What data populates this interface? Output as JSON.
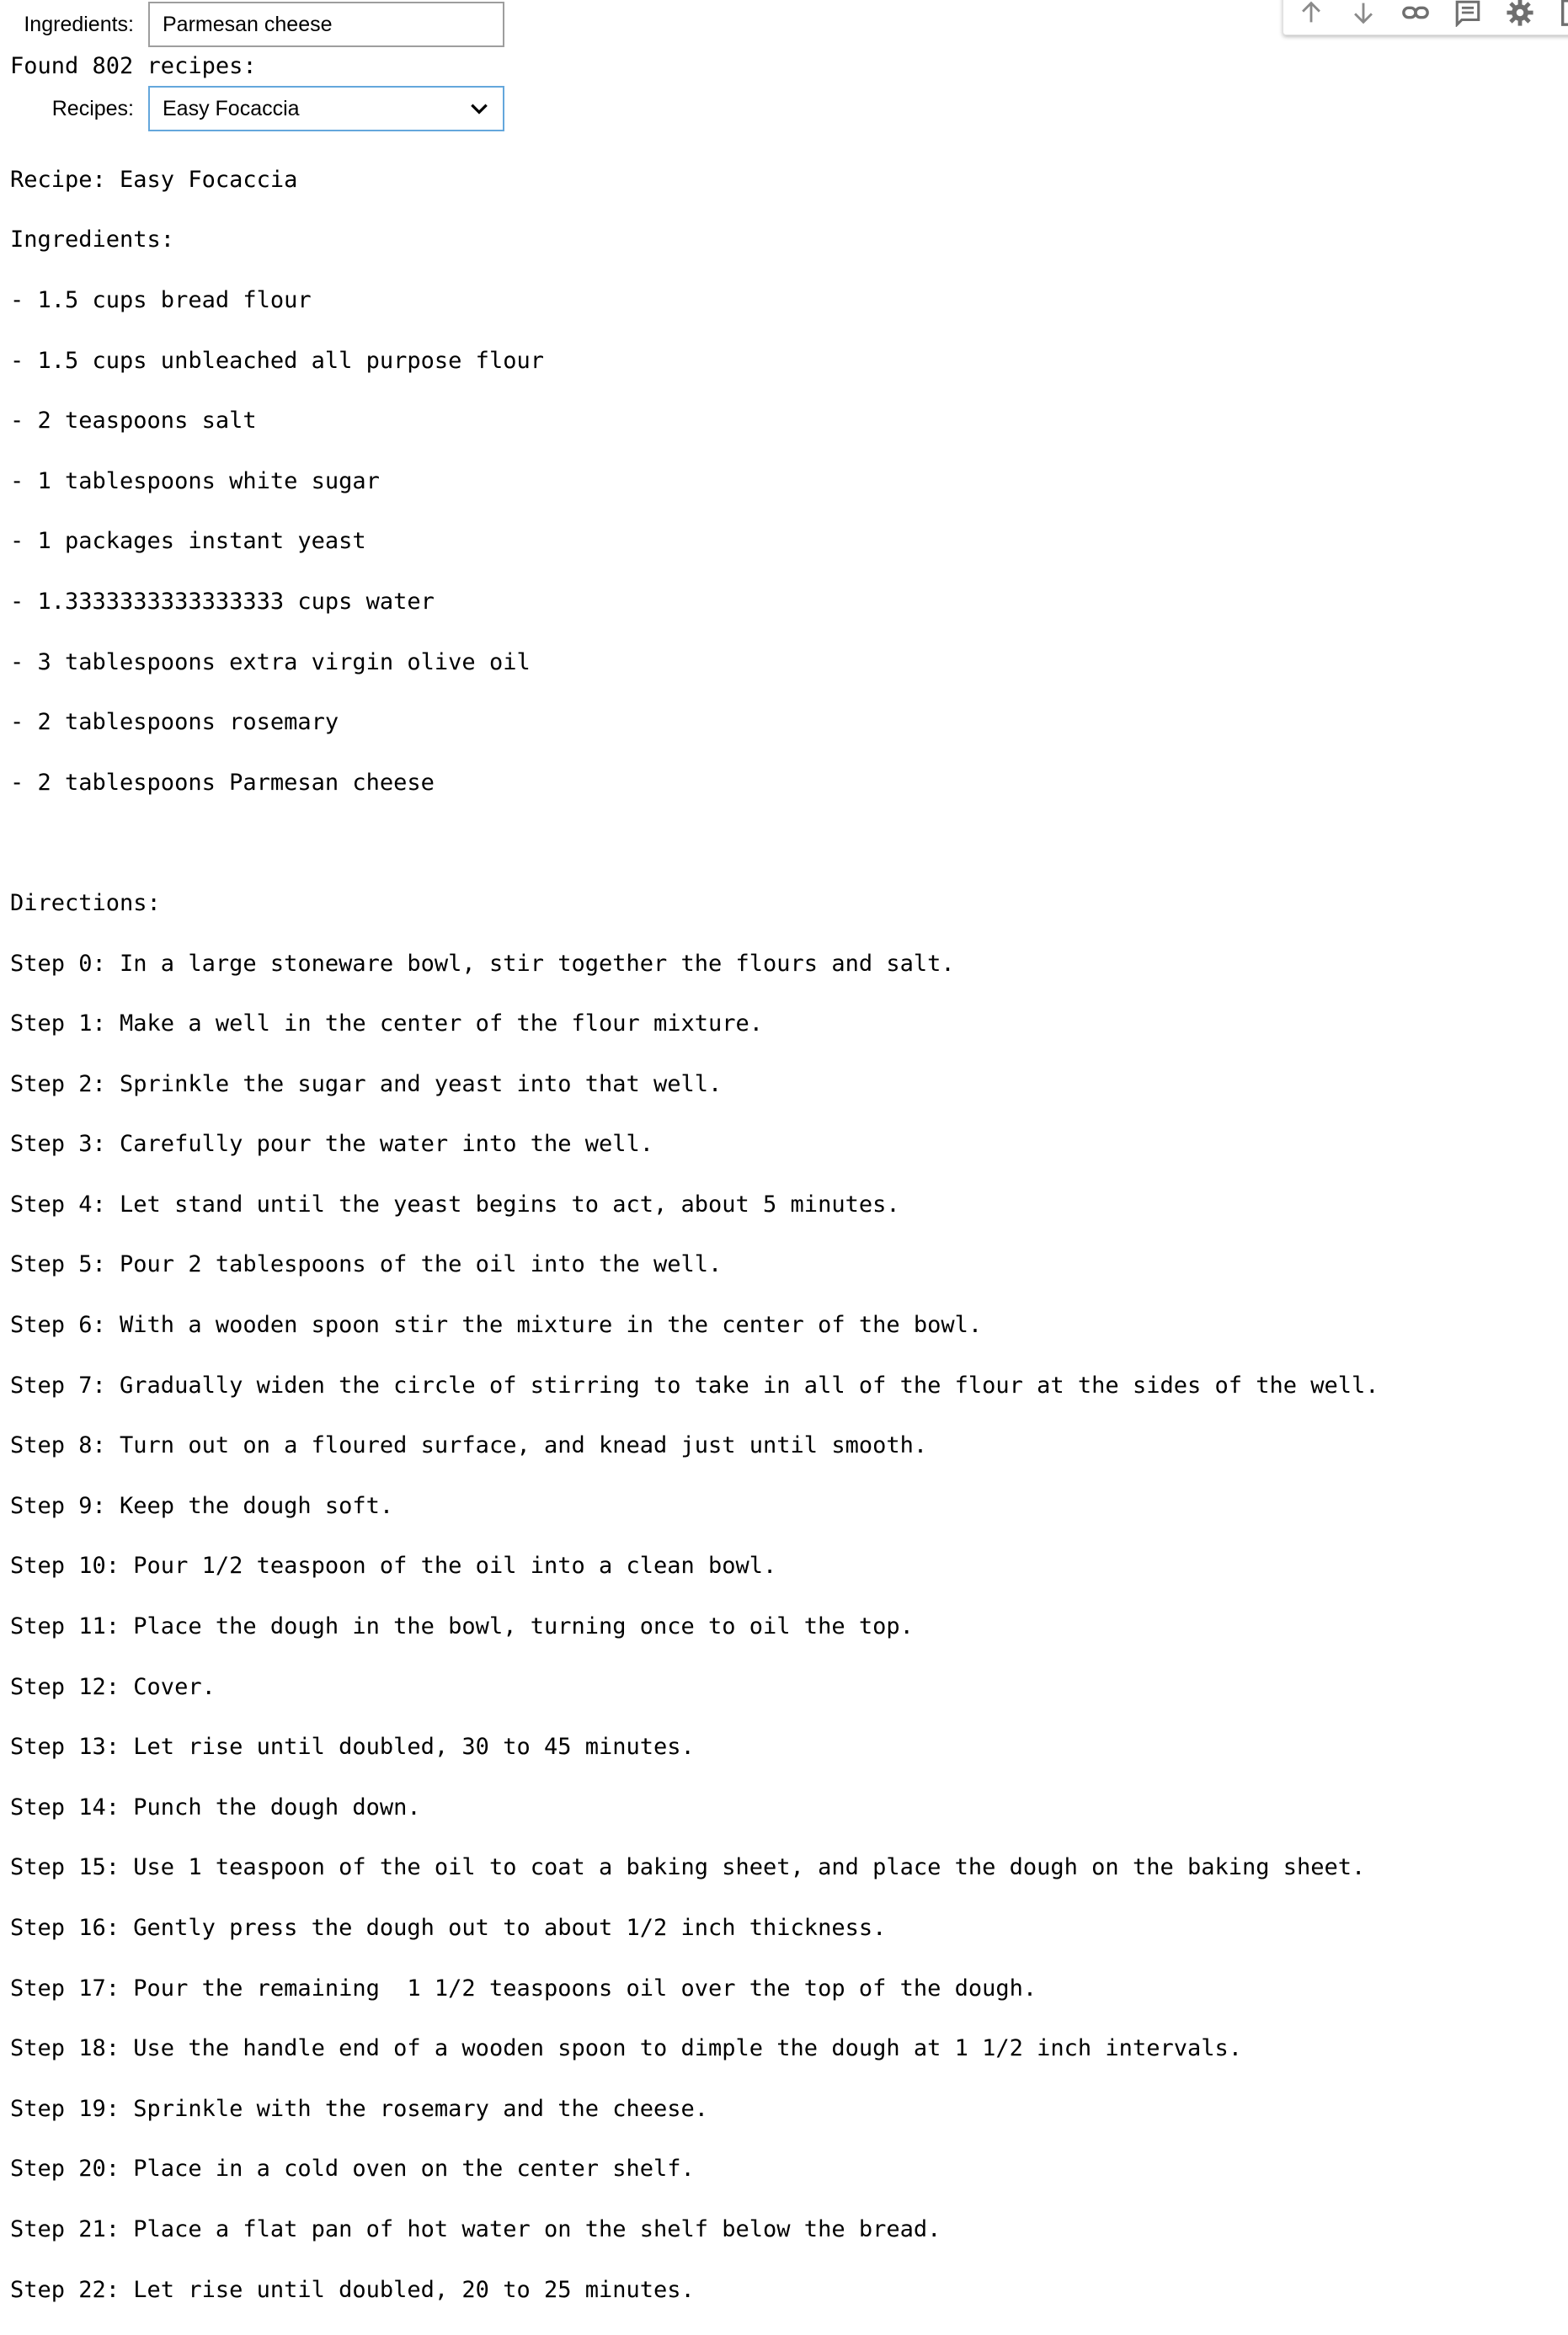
{
  "ingredients_widget": {
    "label": "Ingredients:",
    "value": "Parmesan cheese"
  },
  "found_text": "Found 802 recipes:",
  "recipes_widget": {
    "label": "Recipes:",
    "selected": "Easy Focaccia"
  },
  "recipe": {
    "title_line": "Recipe: Easy Focaccia",
    "ingredients_header": "Ingredients:",
    "ingredients": [
      "- 1.5 cups bread flour",
      "- 1.5 cups unbleached all purpose flour",
      "- 2 teaspoons salt",
      "- 1 tablespoons white sugar",
      "- 1 packages instant yeast",
      "- 1.3333333333333333 cups water",
      "- 3 tablespoons extra virgin olive oil",
      "- 2 tablespoons rosemary",
      "- 2 tablespoons Parmesan cheese"
    ],
    "directions_header": "Directions:",
    "steps": [
      "Step 0: In a large stoneware bowl, stir together the flours and salt.",
      "Step 1: Make a well in the center of the flour mixture.",
      "Step 2: Sprinkle the sugar and yeast into that well.",
      "Step 3: Carefully pour the water into the well.",
      "Step 4: Let stand until the yeast begins to act, about 5 minutes.",
      "Step 5: Pour 2 tablespoons of the oil into the well.",
      "Step 6: With a wooden spoon stir the mixture in the center of the bowl.",
      "Step 7: Gradually widen the circle of stirring to take in all of the flour at the sides of the well.",
      "Step 8: Turn out on a floured surface, and knead just until smooth.",
      "Step 9: Keep the dough soft.",
      "Step 10: Pour 1/2 teaspoon of the oil into a clean bowl.",
      "Step 11: Place the dough in the bowl, turning once to oil the top.",
      "Step 12: Cover.",
      "Step 13: Let rise until doubled, 30 to 45 minutes.",
      "Step 14: Punch the dough down.",
      "Step 15: Use 1 teaspoon of the oil to coat a baking sheet, and place the dough on the baking sheet.",
      "Step 16: Gently press the dough out to about 1/2 inch thickness.",
      "Step 17: Pour the remaining  1 1/2 teaspoons oil over the top of the dough.",
      "Step 18: Use the handle end of a wooden spoon to dimple the dough at 1 1/2 inch intervals.",
      "Step 19: Sprinkle with the rosemary and the cheese.",
      "Step 20: Place in a cold oven on the center shelf.",
      "Step 21: Place a flat pan of hot water on the shelf below the bread.",
      "Step 22: Let rise until doubled, 20 to 25 minutes."
    ]
  },
  "toolbar": {
    "icons": [
      "arrow-up-icon",
      "arrow-down-icon",
      "link-icon",
      "comment-icon",
      "gear-icon",
      "more-icon"
    ]
  },
  "colors": {
    "select_border": "#64a7dc",
    "input_border": "#9e9e9e",
    "toolbar_icon": "#7a7a7a"
  }
}
